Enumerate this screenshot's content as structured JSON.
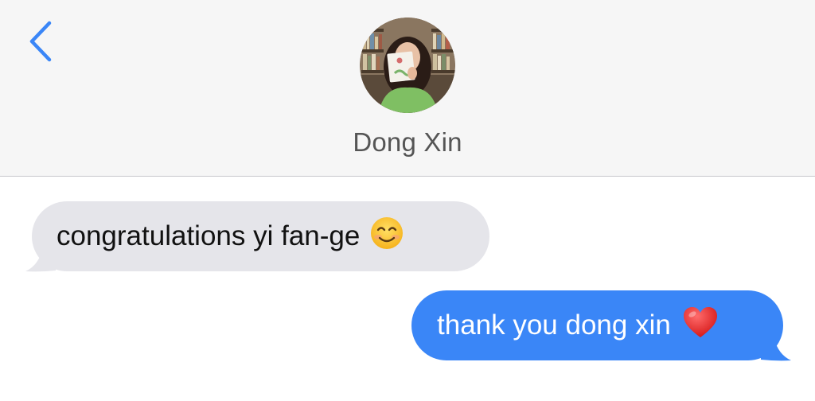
{
  "header": {
    "back_icon": "chevron-left-icon",
    "contact_name": "Dong Xin",
    "avatar_icon": "contact-photo"
  },
  "messages": [
    {
      "direction": "incoming",
      "text": "congratulations yi fan-ge",
      "emoji": "smiling-face-icon"
    },
    {
      "direction": "outgoing",
      "text": "thank you dong xin",
      "emoji": "red-heart-icon"
    }
  ],
  "colors": {
    "accent": "#3a86f7",
    "incoming_bubble": "#e5e5ea",
    "header_bg": "#f6f6f6"
  }
}
